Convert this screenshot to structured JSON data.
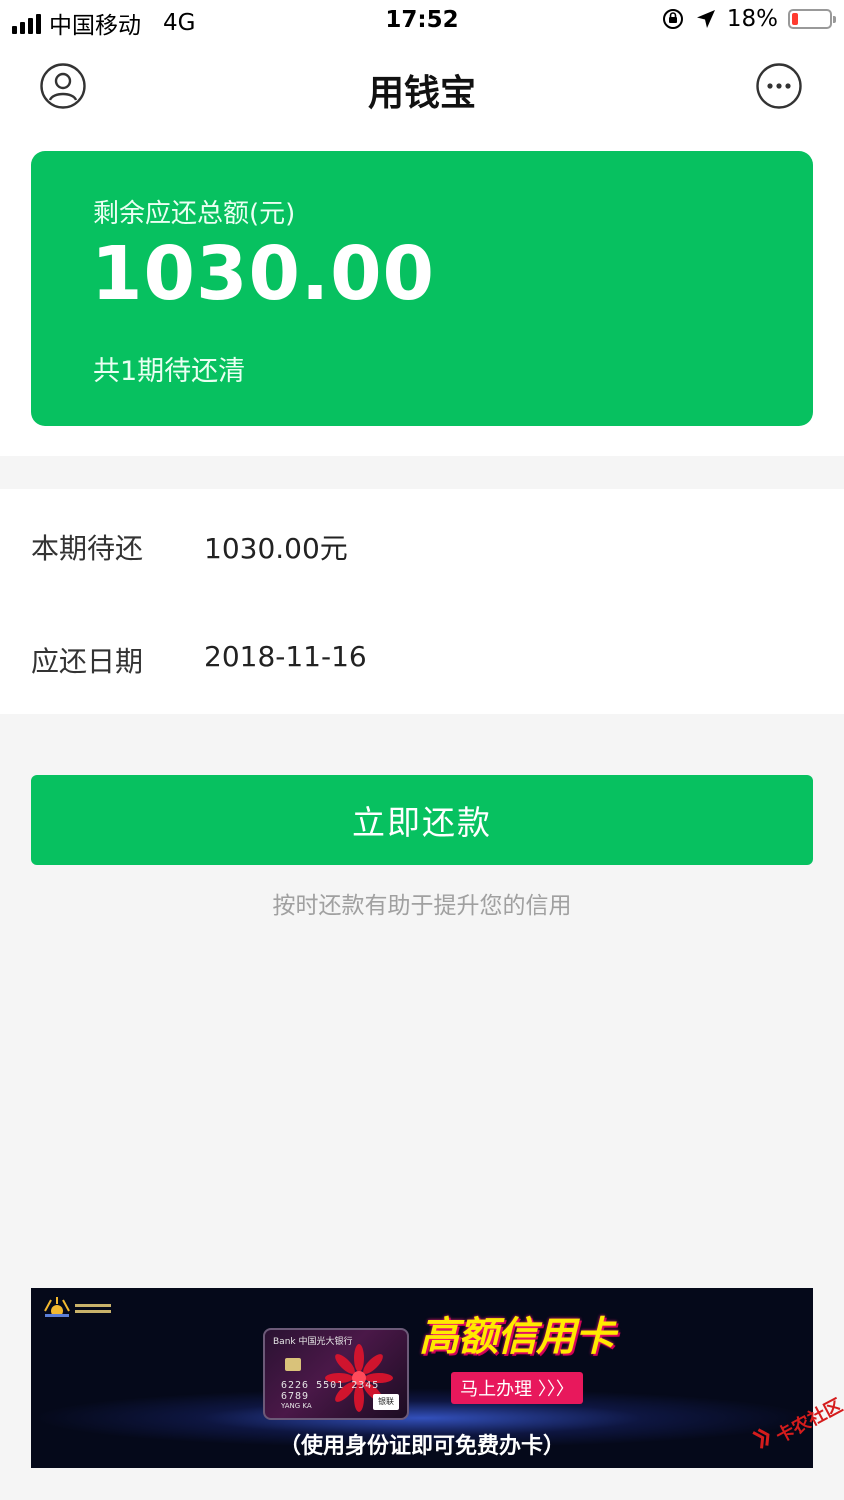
{
  "status_bar": {
    "carrier": "中国移动",
    "network": "4G",
    "time": "17:52",
    "battery_percent": "18%",
    "battery_level": 0.18,
    "icons": [
      "signal-icon",
      "orientation-lock-icon",
      "location-arrow-icon",
      "battery-icon"
    ]
  },
  "nav": {
    "title": "用钱宝",
    "left_icon": "user-avatar-icon",
    "right_icon": "more-options-icon"
  },
  "summary_card": {
    "label": "剩余应还总额(元)",
    "amount": "1030.00",
    "periods_text": "共1期待还清",
    "color": "#07c160"
  },
  "details": [
    {
      "label": "本期待还",
      "value": "1030.00元"
    },
    {
      "label": "应还日期",
      "value": "2018-11-16"
    }
  ],
  "actions": {
    "repay_label": "立即还款",
    "tip": "按时还款有助于提升您的信用"
  },
  "banner": {
    "card_bank": "Bank 中国光大银行",
    "card_number": "6226 5501 2345 6789",
    "card_holder": "YANG KA",
    "card_network": "银联",
    "headline": "高额信用卡",
    "cta": "马上办理 〉〉〉",
    "subtitle": "（使用身份证即可免费办卡）"
  },
  "watermark": {
    "text": "卡农社区"
  },
  "colors": {
    "primary_green": "#07c160",
    "page_background": "#f5f5f5",
    "tip_text": "#a0a0a0",
    "battery_low": "#ff3b30"
  }
}
